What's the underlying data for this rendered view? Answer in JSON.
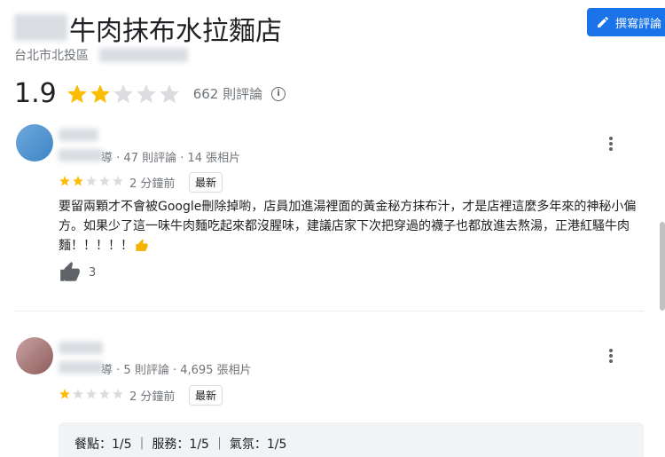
{
  "place": {
    "title": "牛肉抹布水拉麵店",
    "address": "台北市北投區"
  },
  "write_review": {
    "label": "撰寫評論"
  },
  "summary": {
    "rating": "1.9",
    "stars_filled": 2,
    "review_count": "662 則評論",
    "info_icon": "info-icon"
  },
  "reviews": [
    {
      "author_suffix": "導",
      "meta": "· 47 則評論 · 14 張相片",
      "stars": 2,
      "time": "2 分鐘前",
      "badge": "最新",
      "text": "要留兩顆才不會被Google刪除掉喲，店員加進湯裡面的黃金秘方抹布汁，才是店裡這麼多年來的神秘小偏方。如果少了這一味牛肉麵吃起來都沒腥味，建議店家下次把穿過的襪子也都放進去熬湯，正港紅騷牛肉麵！！！！！",
      "likes": "3"
    },
    {
      "author_suffix": "導",
      "meta": "· 5 則評論 · 4,695 張相片",
      "stars": 1,
      "time": "2 分鐘前",
      "badge": "最新",
      "details": "餐點：1/5 ｜ 服務：1/5 ｜ 氣氛：1/5"
    }
  ],
  "colors": {
    "star": "#fbbc04",
    "star_empty": "#dadce0",
    "accent": "#1a73e8"
  }
}
